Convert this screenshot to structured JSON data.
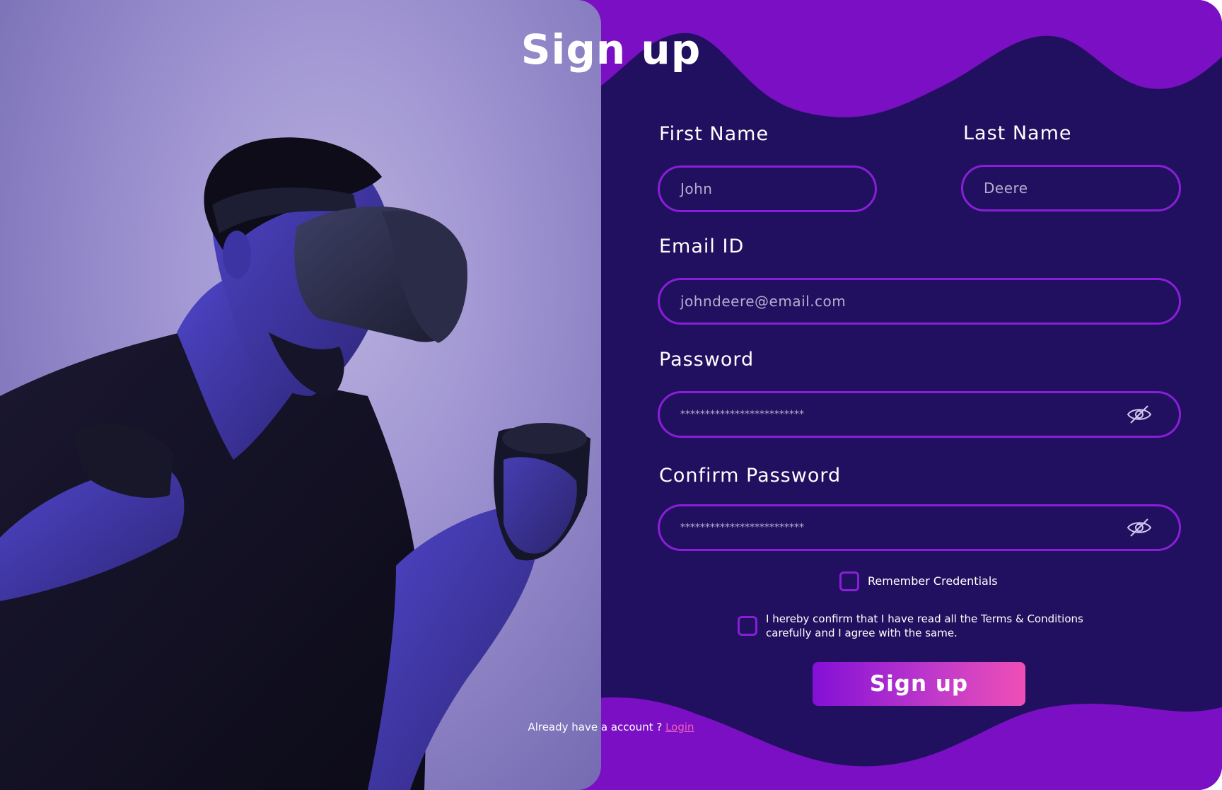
{
  "form": {
    "title": "Sign up",
    "first_name": {
      "label": "First Name",
      "value": "John"
    },
    "last_name": {
      "label": "Last Name",
      "value": "Deere"
    },
    "email": {
      "label": "Email ID",
      "value": "johndeere@email.com"
    },
    "password": {
      "label": "Password",
      "value": "*************************"
    },
    "confirm_password": {
      "label": "Confirm Password",
      "value": "*************************"
    },
    "remember": {
      "label": "Remember Credentials",
      "checked": false
    },
    "terms": {
      "label": "I hereby confirm that I have read all the Terms & Conditions carefully and I agree with the same.",
      "checked": false
    },
    "submit_label": "Sign up",
    "account_prompt": "Already have a account ?",
    "login_link": "Login"
  },
  "icons": {
    "password_toggle": "eye-slash-icon",
    "confirm_toggle": "eye-slash-icon"
  },
  "colors": {
    "panel_background": "#21105f",
    "wave_purple": "#7a0fc4",
    "field_border": "#8a1ed8",
    "button_gradient_start": "#8410d6",
    "button_gradient_end": "#ef4fb6",
    "link": "#f25fbd"
  }
}
